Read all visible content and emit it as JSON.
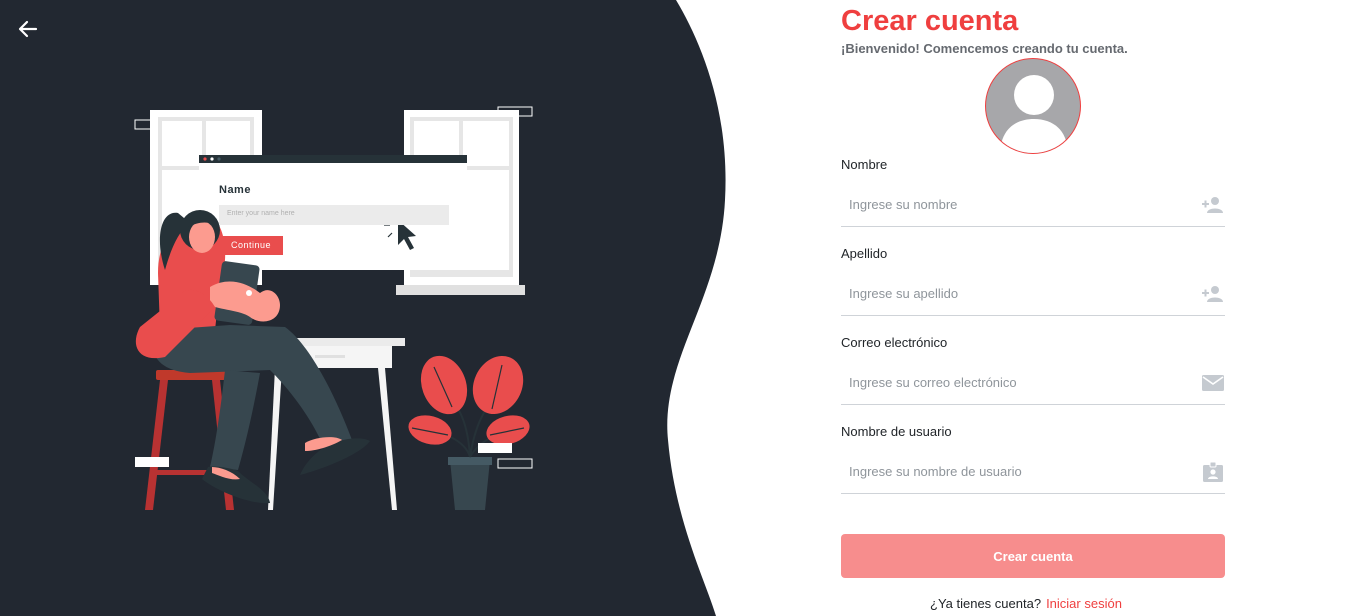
{
  "nav": {
    "back_icon": "arrow-left-icon"
  },
  "illustration": {
    "field_label": "Name",
    "field_placeholder": "Enter your name here",
    "button_label": "Continue"
  },
  "form": {
    "title": "Crear cuenta",
    "subtitle": "¡Bienvenido! Comencemos creando tu cuenta.",
    "avatar_icon": "user-avatar-icon",
    "fields": [
      {
        "label": "Nombre",
        "placeholder": "Ingrese su nombre",
        "icon": "person-add-icon"
      },
      {
        "label": "Apellido",
        "placeholder": "Ingrese su apellido",
        "icon": "person-add-icon"
      },
      {
        "label": "Correo electrónico",
        "placeholder": "Ingrese su correo electrónico",
        "icon": "mail-icon"
      },
      {
        "label": "Nombre de usuario",
        "placeholder": "Ingrese su nombre de usuario",
        "icon": "id-badge-icon"
      }
    ],
    "submit_label": "Crear cuenta",
    "login_prompt": "¿Ya tienes cuenta?",
    "login_link": "Iniciar sesión"
  },
  "colors": {
    "accent": "#ef3f3f",
    "button": "#f78d8d",
    "dark_panel": "#222831"
  }
}
